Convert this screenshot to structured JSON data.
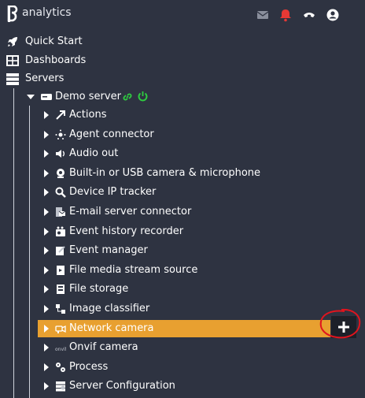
{
  "app": {
    "name": "analytics"
  },
  "topbar_icons": [
    "mail-icon",
    "bell-icon",
    "phone-icon",
    "user-icon"
  ],
  "colors": {
    "background": "#2e3341",
    "active": "#e8a030",
    "bell": "#e53935",
    "link": "#2ecc40",
    "annotation": "#e0141e"
  },
  "nav": {
    "quick_start": "Quick Start",
    "dashboards": "Dashboards",
    "servers": "Servers"
  },
  "server": {
    "name": "Demo server"
  },
  "tree": [
    {
      "label": "Actions",
      "icon": "actions-icon"
    },
    {
      "label": "Agent connector",
      "icon": "agent-icon"
    },
    {
      "label": "Audio out",
      "icon": "speaker-icon"
    },
    {
      "label": "Built-in or USB camera & microphone",
      "icon": "webcam-icon"
    },
    {
      "label": "Device IP tracker",
      "icon": "search-icon"
    },
    {
      "label": "E-mail server connector",
      "icon": "email-server-icon"
    },
    {
      "label": "Event history recorder",
      "icon": "recorder-icon"
    },
    {
      "label": "Event manager",
      "icon": "event-manager-icon"
    },
    {
      "label": "File media stream source",
      "icon": "file-media-icon"
    },
    {
      "label": "File storage",
      "icon": "storage-icon"
    },
    {
      "label": "Image classifier",
      "icon": "classifier-icon"
    },
    {
      "label": "Network camera",
      "icon": "camera-icon",
      "active": true
    },
    {
      "label": "Onvif camera",
      "icon": "onvif-icon"
    },
    {
      "label": "Process",
      "icon": "process-icon"
    },
    {
      "label": "Server Configuration",
      "icon": "config-icon"
    }
  ]
}
